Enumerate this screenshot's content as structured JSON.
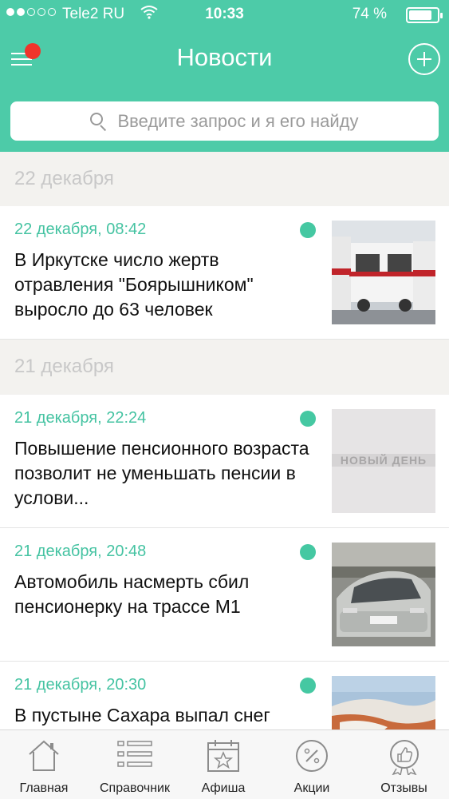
{
  "status": {
    "carrier": "Tele2 RU",
    "time": "10:33",
    "battery": "74 %"
  },
  "header": {
    "title": "Новости"
  },
  "search": {
    "placeholder": "Введите запрос и я его найду"
  },
  "feed": {
    "groups": [
      {
        "date": "22 декабря"
      },
      {
        "date": "21 декабря"
      }
    ],
    "items": [
      {
        "time": "22 декабря, 08:42",
        "headline": "В Иркутске число жертв отравления \"Боярышником\" выросло до 63 человек"
      },
      {
        "time": "21 декабря, 22:24",
        "headline": "Повышение пенсионного возраста позволит не уменьшать пенсии в услови..."
      },
      {
        "time": "21 декабря, 20:48",
        "headline": "Автомобиль насмерть сбил пенсионерку на трассе М1"
      },
      {
        "time": "21 декабря, 20:30",
        "headline": "В пустыне Сахара выпал снег"
      }
    ],
    "thumb2_text": "НОВЫЙ ДЕНЬ"
  },
  "tabbar": {
    "items": [
      {
        "label": "Главная",
        "icon": "home-icon"
      },
      {
        "label": "Справочник",
        "icon": "list-icon"
      },
      {
        "label": "Афиша",
        "icon": "calendar-star-icon"
      },
      {
        "label": "Акции",
        "icon": "percent-icon"
      },
      {
        "label": "Отзывы",
        "icon": "thumbs-up-badge-icon"
      }
    ]
  },
  "colors": {
    "accent": "#4dcba8",
    "notification_badge": "#f0342b",
    "unread_dot": "#45c8a2"
  }
}
